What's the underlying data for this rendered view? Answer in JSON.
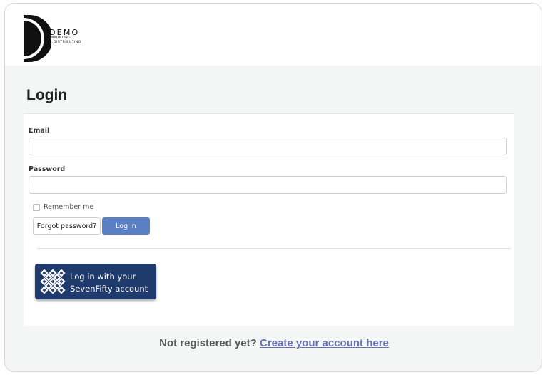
{
  "brand": {
    "name": "DEMO",
    "tagline_line1": "IMPORTING",
    "tagline_line2": "& DISTRIBUTING"
  },
  "page": {
    "title": "Login"
  },
  "form": {
    "email_label": "Email",
    "email_value": "",
    "password_label": "Password",
    "password_value": "",
    "remember_label": "Remember me",
    "remember_checked": false,
    "forgot_label": "Forgot password?",
    "login_label": "Log in"
  },
  "sso": {
    "line1": "Log in with your",
    "line2": "SevenFifty account",
    "icon": "sevenfifty-logo-icon"
  },
  "footer": {
    "prompt": "Not registered yet?",
    "link_text": "Create your account here"
  },
  "colors": {
    "primary_button": "#5b7fc4",
    "sso_button": "#1f3a6c",
    "link": "#6a70b5",
    "background": "#f4f5f5"
  }
}
